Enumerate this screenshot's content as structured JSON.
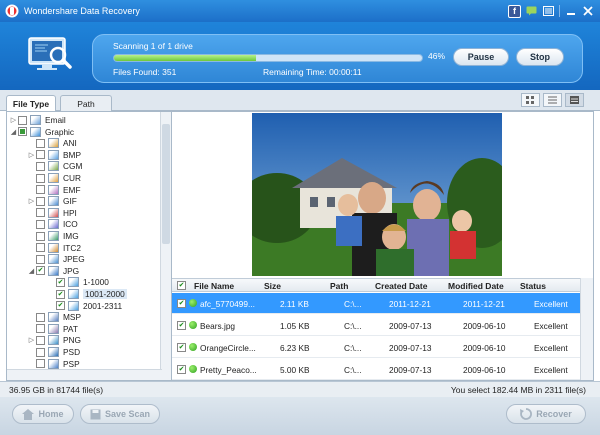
{
  "window": {
    "title": "Wondershare Data Recovery"
  },
  "scan": {
    "status": "Scanning 1 of 1 drive",
    "progress_pct": "46%",
    "progress_fraction": 0.46,
    "files_found": "Files Found: 351",
    "remaining": "Remaining Time: 00:00:11",
    "pause_label": "Pause",
    "stop_label": "Stop"
  },
  "tabs": [
    {
      "label": "File Type"
    },
    {
      "label": "Path"
    }
  ],
  "tree": [
    {
      "label": "Email",
      "check": "none",
      "expander": "▷"
    },
    {
      "label": "Graphic",
      "check": "partial",
      "expander": "◢"
    },
    {
      "label": "ANI",
      "check": "none",
      "expander": ""
    },
    {
      "label": "BMP",
      "check": "none",
      "expander": "▷"
    },
    {
      "label": "CGM",
      "check": "none",
      "expander": ""
    },
    {
      "label": "CUR",
      "check": "none",
      "expander": ""
    },
    {
      "label": "EMF",
      "check": "none",
      "expander": ""
    },
    {
      "label": "GIF",
      "check": "none",
      "expander": "▷"
    },
    {
      "label": "HPI",
      "check": "none",
      "expander": ""
    },
    {
      "label": "ICO",
      "check": "none",
      "expander": ""
    },
    {
      "label": "IMG",
      "check": "none",
      "expander": ""
    },
    {
      "label": "ITC2",
      "check": "none",
      "expander": ""
    },
    {
      "label": "JPEG",
      "check": "none",
      "expander": ""
    },
    {
      "label": "JPG",
      "check": "checked",
      "expander": "◢"
    },
    {
      "label": "1-1000",
      "check": "checked",
      "expander": ""
    },
    {
      "label": "1001-2000",
      "check": "checked",
      "expander": ""
    },
    {
      "label": "2001-2311",
      "check": "checked",
      "expander": ""
    },
    {
      "label": "MSP",
      "check": "none",
      "expander": ""
    },
    {
      "label": "PAT",
      "check": "none",
      "expander": ""
    },
    {
      "label": "PNG",
      "check": "none",
      "expander": "▷"
    },
    {
      "label": "PSD",
      "check": "none",
      "expander": ""
    },
    {
      "label": "PSP",
      "check": "none",
      "expander": ""
    }
  ],
  "table": {
    "headers": [
      "File Name",
      "Size",
      "Path",
      "Created Date",
      "Modified Date",
      "Status"
    ],
    "rows": [
      {
        "name": "afc_5770499...",
        "size": "2.11 KB",
        "path": "C:\\...",
        "created": "2011-12-21",
        "modified": "2011-12-21",
        "status": "Excellent"
      },
      {
        "name": "Bears.jpg",
        "size": "1.05 KB",
        "path": "C:\\...",
        "created": "2009-07-13",
        "modified": "2009-06-10",
        "status": "Excellent"
      },
      {
        "name": "OrangeCircle...",
        "size": "6.23 KB",
        "path": "C:\\...",
        "created": "2009-07-13",
        "modified": "2009-06-10",
        "status": "Excellent"
      },
      {
        "name": "Pretty_Peaco...",
        "size": "5.00 KB",
        "path": "C:\\...",
        "created": "2009-07-13",
        "modified": "2009-06-10",
        "status": "Excellent"
      }
    ]
  },
  "statusbar": {
    "left": "36.95 GB in 81744 file(s)",
    "right": "You select 182.44 MB in 2311 file(s)"
  },
  "footer": {
    "home": "Home",
    "save_scan": "Save Scan",
    "recover": "Recover"
  },
  "colors": {
    "accent": "#1c6fc8",
    "selection": "#3399ff",
    "progress": "#6dc83a"
  }
}
